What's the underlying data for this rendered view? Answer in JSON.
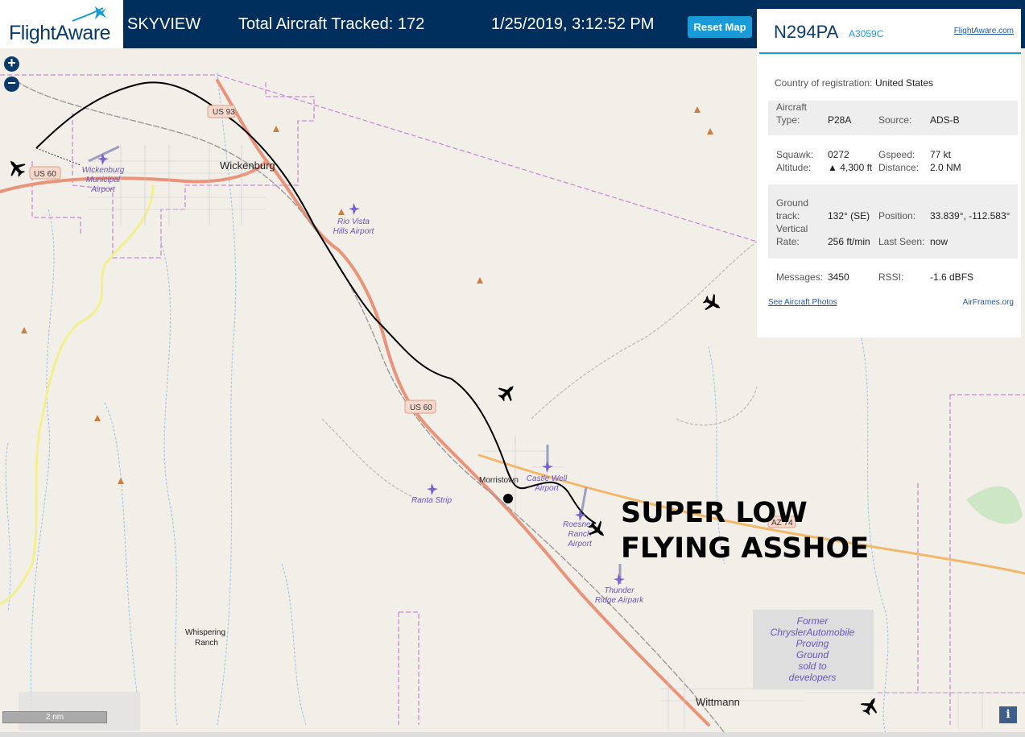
{
  "header": {
    "logo": "FlightAware",
    "app_name": "SKYVIEW",
    "aircraft_tracked": "Total Aircraft Tracked: 172",
    "datetime": "1/25/2019, 3:12:52 PM",
    "reset_label": "Reset Map"
  },
  "map_controls": {
    "zoom_in": "+",
    "zoom_out": "−",
    "scale_label": "2 nm",
    "info": "i"
  },
  "map_labels": {
    "towns": [
      "Wickenburg",
      "Morristown",
      "Wittmann",
      "Whispering",
      "Ranch"
    ],
    "roads": [
      "US 93",
      "US 60",
      "US 60",
      "AZ 74"
    ],
    "airports": [
      "Wickenburg",
      "Municipal",
      "Airport",
      "Rio Vista",
      "Hills Airport",
      "Castle Well",
      "Airport",
      "Ranta Strip",
      "Roesner",
      "Ranch",
      "Airport",
      "Thunder",
      "Ridge Airpark"
    ],
    "proving_ground": [
      "Former",
      "ChryslerAutomobile",
      "Proving",
      "Ground",
      "sold to",
      "developers"
    ]
  },
  "annotation": {
    "line1": "SUPER LOW",
    "line2": "FLYING ASSHOE"
  },
  "aircraft_panel": {
    "registration": "N294PA",
    "hex": "A3059C",
    "link": "FlightAware.com",
    "country_label": "Country of registration:",
    "country_value": "United States",
    "aircraft_type_label": [
      "Aircraft",
      "Type:"
    ],
    "aircraft_type_value": "P28A",
    "source_label": "Source:",
    "source_value": "ADS-B",
    "squawk_label": "Squawk:",
    "squawk_value": "0272",
    "gspeed_label": "Gspeed:",
    "gspeed_value": "77 kt",
    "altitude_label": "Altitude:",
    "altitude_value": "▲ 4,300 ft",
    "distance_label": "Distance:",
    "distance_value": "2.0 NM",
    "ground_track_label": [
      "Ground",
      "track:"
    ],
    "ground_track_value": "132° (SE)",
    "position_label": "Position:",
    "position_value": "33.839°, -112.583°",
    "vertical_rate_label": [
      "Vertical",
      "Rate:"
    ],
    "vertical_rate_value": "256 ft/min",
    "last_seen_label": "Last Seen:",
    "last_seen_value": "now",
    "messages_label": "Messages:",
    "messages_value": "3450",
    "rssi_label": "RSSI:",
    "rssi_value": "-1.6 dBFS",
    "photos_link": "See Aircraft Photos",
    "airframes_link": "AirFrames.org"
  },
  "colors": {
    "header_bg": "#002f5d",
    "accent": "#1a9bd7",
    "map_bg": "#f2efe9",
    "road": "#e8937a",
    "boundary": "#c88bd6"
  }
}
